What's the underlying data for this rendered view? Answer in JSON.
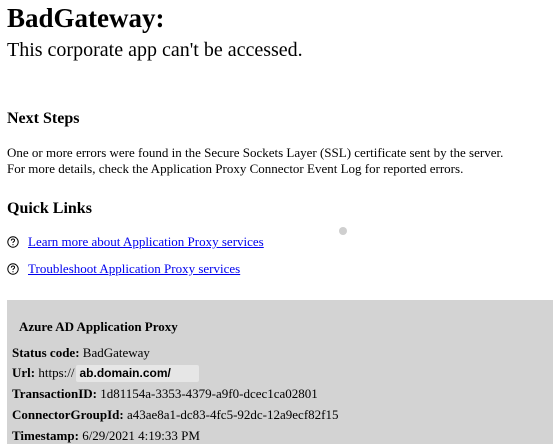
{
  "header": {
    "title": "BadGateway:",
    "subtitle": "This corporate app can't be accessed."
  },
  "next_steps": {
    "heading": "Next Steps",
    "lines": [
      "One or more errors were found in the Secure Sockets Layer (SSL) certificate sent by the server.",
      "For more details, check the Application Proxy Connector Event Log for reported errors."
    ]
  },
  "quick_links": {
    "heading": "Quick Links",
    "items": [
      {
        "label": "Learn more about Application Proxy services",
        "icon": "help-circle-icon"
      },
      {
        "label": "Troubleshoot Application Proxy services",
        "icon": "help-circle-icon"
      }
    ]
  },
  "info_panel": {
    "title": "Azure AD Application Proxy",
    "status_code_label": "Status code:",
    "status_code_value": "BadGateway",
    "url_label": "Url:",
    "url_scheme": "https://",
    "url_host": "ab.domain.com/",
    "transaction_label": "TransactionID:",
    "transaction_value": "1d81154a-3353-4379-a9f0-dcec1ca02801",
    "connector_group_label": "ConnectorGroupId:",
    "connector_group_value": "a43ae8a1-dc83-4fc5-92dc-12a9ecf82f15",
    "timestamp_label": "Timestamp:",
    "timestamp_value": "6/29/2021 4:19:33 PM"
  },
  "colors": {
    "link": "#0000ee",
    "panel_background": "#d3d3d3"
  }
}
